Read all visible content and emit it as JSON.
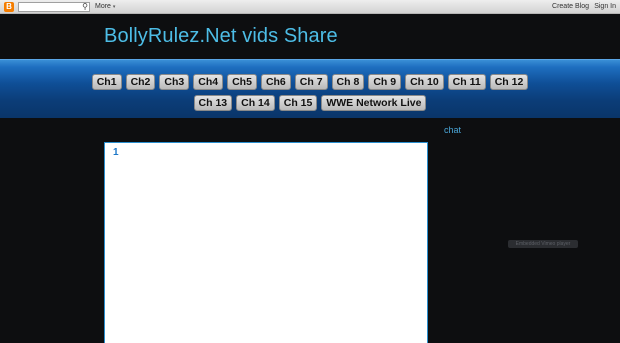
{
  "navbar": {
    "logo_letter": "B",
    "search_placeholder": "",
    "more_label": "More",
    "more_caret": "▾",
    "create_blog_label": "Create Blog",
    "sign_in_label": "Sign In"
  },
  "header": {
    "title": "BollyRulez.Net vids Share"
  },
  "nav": {
    "row1": [
      "Ch1",
      "Ch2",
      "Ch3",
      "Ch4",
      "Ch5",
      "Ch6",
      "Ch 7",
      "Ch 8",
      "Ch 9",
      "Ch 10",
      "Ch 11",
      "Ch 12"
    ],
    "row2": [
      "Ch 13",
      "Ch 14",
      "Ch 15",
      "WWE Network Live"
    ]
  },
  "main": {
    "post_title": "1"
  },
  "sidebar": {
    "title": "chat",
    "embed_label": "Embedded Vimeo player"
  },
  "colors": {
    "background": "#0d0e10",
    "accent": "#4dbde6",
    "nav_blue": "#0f4f97"
  }
}
